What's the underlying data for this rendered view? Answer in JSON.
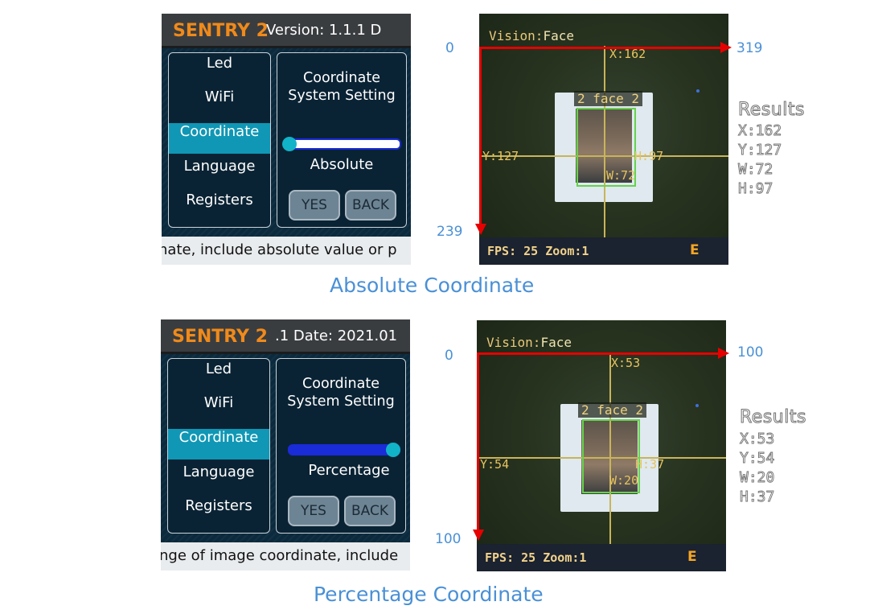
{
  "sections": [
    {
      "device": {
        "brand": "SENTRY 2",
        "header_text": "Version: 1.1.1 D",
        "menu_items": [
          "Led",
          "WiFi",
          "Coordinate",
          "Language",
          "Registers"
        ],
        "selected_item": "Coordinate",
        "setting_title_line1": "Coordinate",
        "setting_title_line2": "System Setting",
        "mode": "Absolute",
        "slider_position": 0,
        "yes_label": "YES",
        "back_label": "BACK",
        "footer_ticker": "nate, include absolute value or p"
      },
      "camera": {
        "vision_label": "Vision:",
        "vision_value": "Face",
        "face_label": "2  face 2",
        "x_readout": "X:162",
        "y_readout": "Y:127",
        "w_readout": "W:72",
        "h_readout": "H:97",
        "fps_text": "FPS: 25  Zoom:1",
        "e_label": "E"
      },
      "axis": {
        "origin": "0",
        "x_max": "319",
        "y_max": "239"
      },
      "results": {
        "title": "Results",
        "x": "X:162",
        "y": "Y:127",
        "w": "W:72",
        "h": "H:97"
      },
      "caption": "Absolute Coordinate"
    },
    {
      "device": {
        "brand": "SENTRY 2",
        "header_text": ".1 Date: 2021.01",
        "menu_items": [
          "Led",
          "WiFi",
          "Coordinate",
          "Language",
          "Registers"
        ],
        "selected_item": "Coordinate",
        "setting_title_line1": "Coordinate",
        "setting_title_line2": "System Setting",
        "mode": "Percentage",
        "slider_position": 1,
        "yes_label": "YES",
        "back_label": "BACK",
        "footer_ticker": "nge of image coordinate, include"
      },
      "camera": {
        "vision_label": "Vision:",
        "vision_value": "Face",
        "face_label": "2  face 2",
        "x_readout": "X:53",
        "y_readout": "Y:54",
        "w_readout": "W:20",
        "h_readout": "H:37",
        "fps_text": "FPS: 25  Zoom:1",
        "e_label": "E"
      },
      "axis": {
        "origin": "0",
        "x_max": "100",
        "y_max": "100"
      },
      "results": {
        "title": "Results",
        "x": "X:53",
        "y": "Y:54",
        "w": "W:20",
        "h": "H:37"
      },
      "caption": "Percentage Coordinate"
    }
  ],
  "colors": {
    "brand": "#f08a1a",
    "selected": "#1097b5",
    "axis": "#e60000",
    "accent_text": "#4a90d6",
    "bbox": "#66d34a"
  }
}
